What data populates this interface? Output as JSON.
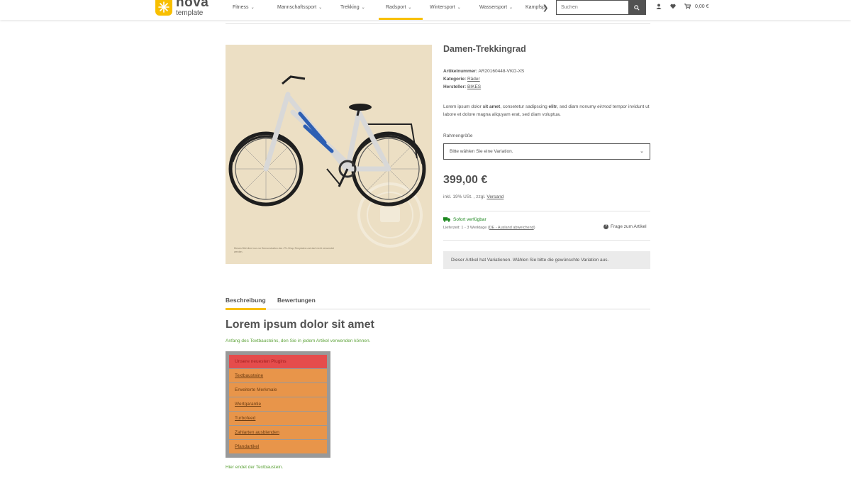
{
  "header": {
    "logo_line1": "nova",
    "logo_line2": "template",
    "nav": [
      {
        "label": "Fitness",
        "active": false
      },
      {
        "label": "Mannschaftssport",
        "active": false
      },
      {
        "label": "Trekking",
        "active": false
      },
      {
        "label": "Radsport",
        "active": true
      },
      {
        "label": "Wintersport",
        "active": false
      },
      {
        "label": "Wassersport",
        "active": false
      },
      {
        "label": "Kampfsp",
        "active": false
      }
    ],
    "search_placeholder": "Suchen",
    "cart_amount": "0,00 €"
  },
  "product": {
    "title": "Damen-Trekkingrad",
    "sku_label": "Artikelnummer:",
    "sku_value": "AR20160448-VKO-XS",
    "category_label": "Kategorie:",
    "category_value": "Räder",
    "manufacturer_label": "Hersteller:",
    "manufacturer_value": "BIKES",
    "image_notice": "Dieses Bild dient nur zur Demonstration des JTL-Shop-Templates und darf nicht verwendet werden.",
    "description_parts": [
      "Lorem ipsum dolor ",
      "sit amet",
      ", consetetur sadipscing ",
      "elitr",
      ", sed diam nonumy ",
      "eirmod",
      " tempor invidunt ut labore et dolore magna aliquyam erat, sed diam voluptua."
    ],
    "variation_label": "Rahmengröße",
    "variation_placeholder": "Bitte wählen Sie eine Variation.",
    "price": "399,00 €",
    "vat_text": "inkl. 19% USt. , zzgl. ",
    "vat_link": "Versand",
    "availability": "Sofort verfügbar",
    "delivery_text": "Lieferzeit: 1 - 3 Werktage (",
    "delivery_link": "DE - Ausland abweichend",
    "delivery_close": ")",
    "question": "Frage zum Artikel",
    "variation_info": "Dieser Artikel hat Variationen. Wählen Sie bitte die gewünschte Variation aus."
  },
  "tabs": [
    {
      "label": "Beschreibung",
      "active": true
    },
    {
      "label": "Bewertungen",
      "active": false
    }
  ],
  "description": {
    "heading": "Lorem ipsum dolor sit amet",
    "start_text": "Anfang des Textbausteins, den Sie in jedem Artikel verwenden können.",
    "plugins_header": "Unsere neuesten Plugins",
    "plugins": [
      {
        "label": "Textbausteine",
        "link": true
      },
      {
        "label": "Erweiterte Merkmale",
        "link": false
      },
      {
        "label": "Wertgarantie",
        "link": true
      },
      {
        "label": "Turbofeed",
        "link": true
      },
      {
        "label": "Zahlarten ausblenden",
        "link": true
      },
      {
        "label": "Pfandartikel",
        "link": true
      }
    ],
    "end_text": "Hier endet der Textbaustein."
  },
  "colors": {
    "accent": "#f8bf00",
    "text": "#525252",
    "success": "#1c871e",
    "textblock_green": "#5ea33a",
    "plugin_orange": "#e8954a",
    "plugin_red": "#e54c4c"
  },
  "icons": {
    "search": "search-icon",
    "user": "user-icon",
    "wishlist": "heart-icon",
    "cart": "cart-icon",
    "truck": "truck-icon",
    "question": "question-icon",
    "nav_next": "chevron-right-icon"
  }
}
